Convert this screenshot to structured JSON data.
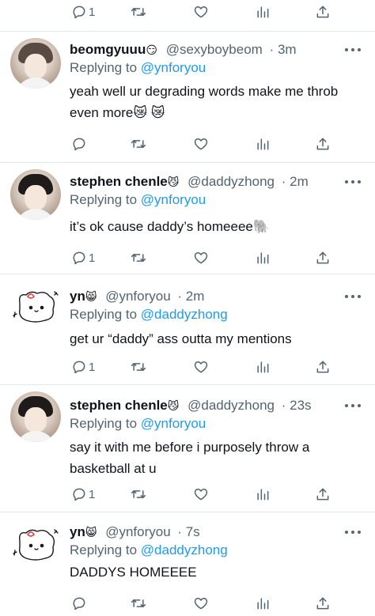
{
  "top_actions": {
    "reply_count": "1"
  },
  "tweets": [
    {
      "name": "beomgyuuu",
      "name_emoji": "😏",
      "handle": "@sexyboybeom",
      "time": "· 3m",
      "replying_label": "Replying to",
      "replying_to": "@ynforyou",
      "text": "yeah well ur degrading words make me throb even more😿 😿",
      "reply_count": ""
    },
    {
      "name": "stephen chenle",
      "name_emoji": "😼",
      "handle": "@daddyzhong",
      "time": "· 2m",
      "replying_label": "Replying to",
      "replying_to": "@ynforyou",
      "text": "it’s ok cause daddy’s homeeee🐘",
      "reply_count": "1"
    },
    {
      "name": "yn",
      "name_emoji": "😸",
      "handle": "@ynforyou",
      "time": "· 2m",
      "replying_label": "Replying to",
      "replying_to": "@daddyzhong",
      "text": "get ur “daddy” ass outta my mentions",
      "reply_count": "1"
    },
    {
      "name": "stephen chenle",
      "name_emoji": "😼",
      "handle": "@daddyzhong",
      "time": "· 23s",
      "replying_label": "Replying to",
      "replying_to": "@ynforyou",
      "text": "say it with me before i purposely throw a basketball at u",
      "reply_count": "1"
    },
    {
      "name": "yn",
      "name_emoji": "😸",
      "handle": "@ynforyou",
      "time": "· 7s",
      "replying_label": "Replying to",
      "replying_to": "@daddyzhong",
      "text": "DADDYS HOMEEEE",
      "reply_count": ""
    }
  ],
  "icons": {
    "reply": "reply-icon",
    "retweet": "retweet-icon",
    "like": "heart-icon",
    "stats": "stats-icon",
    "share": "share-icon",
    "more": "more-icon"
  },
  "colors": {
    "text": "#0f1419",
    "muted": "#536471",
    "link": "#1d9bf0",
    "divider": "#e1e6ea"
  }
}
